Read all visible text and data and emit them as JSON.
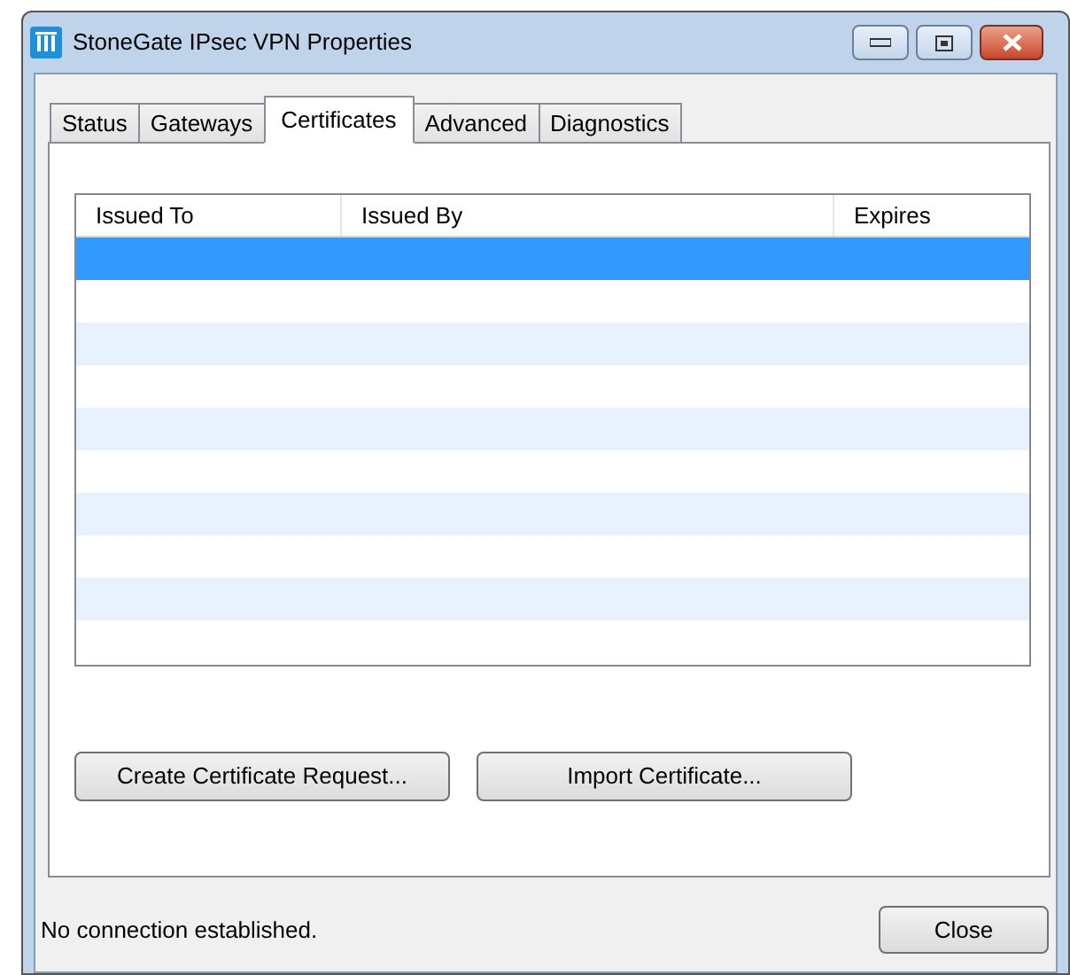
{
  "window": {
    "title": "StoneGate IPsec VPN Properties"
  },
  "tabs": [
    {
      "label": "Status",
      "selected": false
    },
    {
      "label": "Gateways",
      "selected": false
    },
    {
      "label": "Certificates",
      "selected": true
    },
    {
      "label": "Advanced",
      "selected": false
    },
    {
      "label": "Diagnostics",
      "selected": false
    }
  ],
  "table": {
    "columns": [
      "Issued To",
      "Issued By",
      "Expires"
    ],
    "rows": [
      {
        "selected": true
      },
      {
        "selected": false
      },
      {
        "selected": false
      },
      {
        "selected": false
      },
      {
        "selected": false
      },
      {
        "selected": false
      },
      {
        "selected": false
      },
      {
        "selected": false
      },
      {
        "selected": false
      },
      {
        "selected": false
      }
    ]
  },
  "buttons": [
    "Create Certificate Request...",
    "Import Certificate..."
  ],
  "status_bar": {
    "text": "No connection established.",
    "button": "Close"
  }
}
